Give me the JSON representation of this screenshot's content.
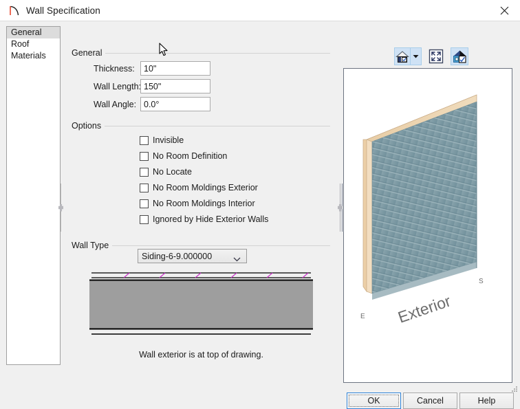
{
  "window": {
    "title": "Wall Specification",
    "icon": "wall-tool-icon",
    "close_icon": "close-icon"
  },
  "sidebar": {
    "items": [
      {
        "label": "General",
        "selected": true
      },
      {
        "label": "Roof",
        "selected": false
      },
      {
        "label": "Materials",
        "selected": false
      }
    ]
  },
  "general": {
    "group_title": "General",
    "fields": [
      {
        "label": "Thickness:",
        "value": "10\""
      },
      {
        "label": "Wall Length:",
        "value": "150\""
      },
      {
        "label": "Wall Angle:",
        "value": "0.0°"
      }
    ]
  },
  "options": {
    "group_title": "Options",
    "items": [
      {
        "label": "Invisible",
        "checked": false
      },
      {
        "label": "No Room Definition",
        "checked": false
      },
      {
        "label": "No Locate",
        "checked": false
      },
      {
        "label": "No Room Moldings Exterior",
        "checked": false
      },
      {
        "label": "No Room Moldings Interior",
        "checked": false
      },
      {
        "label": "Ignored by Hide Exterior Walls",
        "checked": false
      }
    ]
  },
  "wall_type": {
    "group_title": "Wall Type",
    "selected": "Siding-6-9.000000",
    "dropdown_icon": "chevron-down-icon",
    "caption": "Wall exterior is at top of drawing.",
    "section_fill_color": "#9e9e9e",
    "hatch_color": "#cc33cc"
  },
  "preview": {
    "toolbar": [
      {
        "name": "home-view-button",
        "icon": "house-checkbox-icon"
      },
      {
        "name": "home-view-dropdown",
        "icon": "caret-down-icon"
      },
      {
        "name": "fit-to-screen-button",
        "icon": "fit-screen-icon"
      },
      {
        "name": "camera-view-button",
        "icon": "house-camera-icon"
      }
    ],
    "labels": {
      "exterior": "Exterior",
      "marker_left": "E",
      "marker_right": "S"
    },
    "siding_color": "#7e9ba5",
    "framing_color": "#e9cfa8"
  },
  "buttons": {
    "ok": "OK",
    "cancel": "Cancel",
    "help": "Help"
  }
}
